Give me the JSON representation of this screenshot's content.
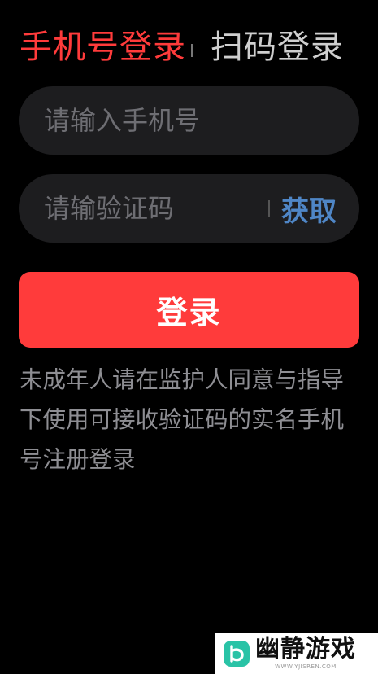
{
  "tabs": {
    "phone_login": "手机号登录",
    "qr_login": "扫码登录"
  },
  "phone_field": {
    "value": "",
    "placeholder": "请输入手机号"
  },
  "code_field": {
    "value": "",
    "placeholder": "请输验证码",
    "get_code_label": "获取"
  },
  "login_button": {
    "label": "登录"
  },
  "notice": {
    "text": "未成年人请在监护人同意与指导下使用可接收验证码的实名手机号注册登录"
  },
  "watermark": {
    "brand": "幽静游戏",
    "url": "WWW.YJISREN.COM"
  },
  "colors": {
    "accent": "#ff3b3b",
    "link": "#4f86c6",
    "logo": "#29c3a6",
    "background": "#000000",
    "field": "#1d1d1f"
  },
  "icons": {
    "watermark_logo": "brand-logo-icon"
  }
}
